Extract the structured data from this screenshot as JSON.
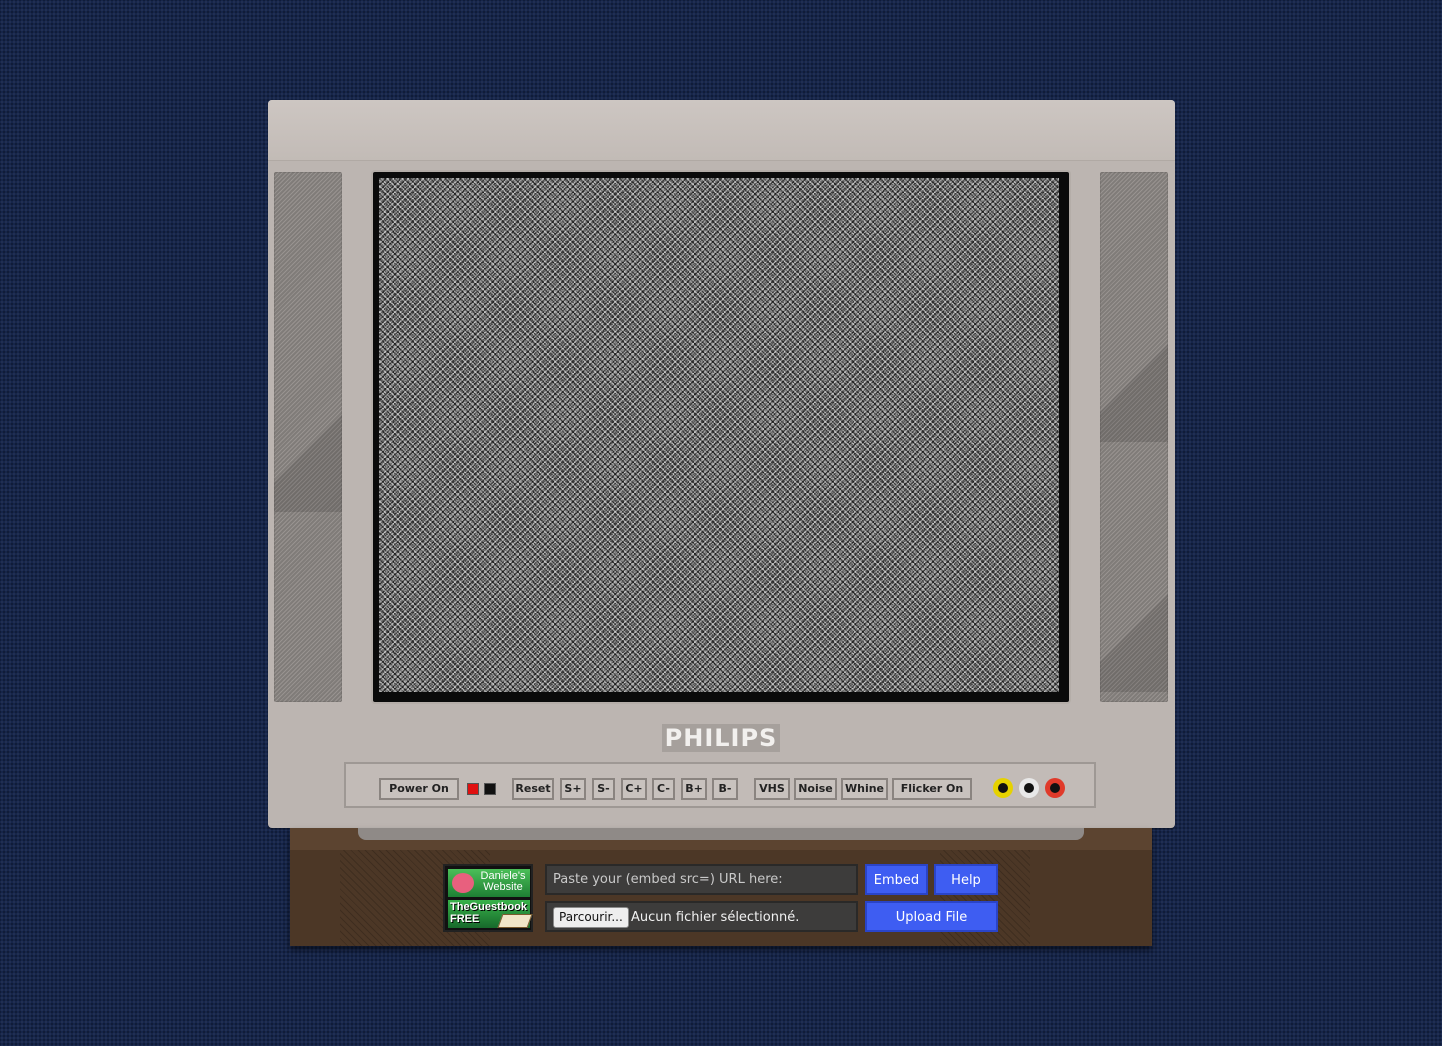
{
  "tv": {
    "brand": "PHILIPS",
    "controls": {
      "power": "Power On",
      "reset": "Reset",
      "saturation_up": "S+",
      "saturation_down": "S-",
      "contrast_up": "C+",
      "contrast_down": "C-",
      "brightness_up": "B+",
      "brightness_down": "B-",
      "vhs": "VHS",
      "noise": "Noise",
      "whine": "Whine",
      "flicker": "Flicker On"
    },
    "leds": {
      "red": "#e01010",
      "black": "#111111"
    },
    "jacks": {
      "yellow": "#e6d200",
      "white": "#e8e8e8",
      "red": "#e03a2a"
    }
  },
  "guestbook": {
    "site_label": "Daniele's Website",
    "banner_label": "TheGuestbook",
    "free_label": "FREE"
  },
  "embed": {
    "url_placeholder": "Paste your (embed src=) URL here:",
    "embed_button": "Embed",
    "help_button": "Help",
    "browse_button": "Parcourir...",
    "file_status": "Aucun fichier sélectionné.",
    "upload_button": "Upload File"
  }
}
